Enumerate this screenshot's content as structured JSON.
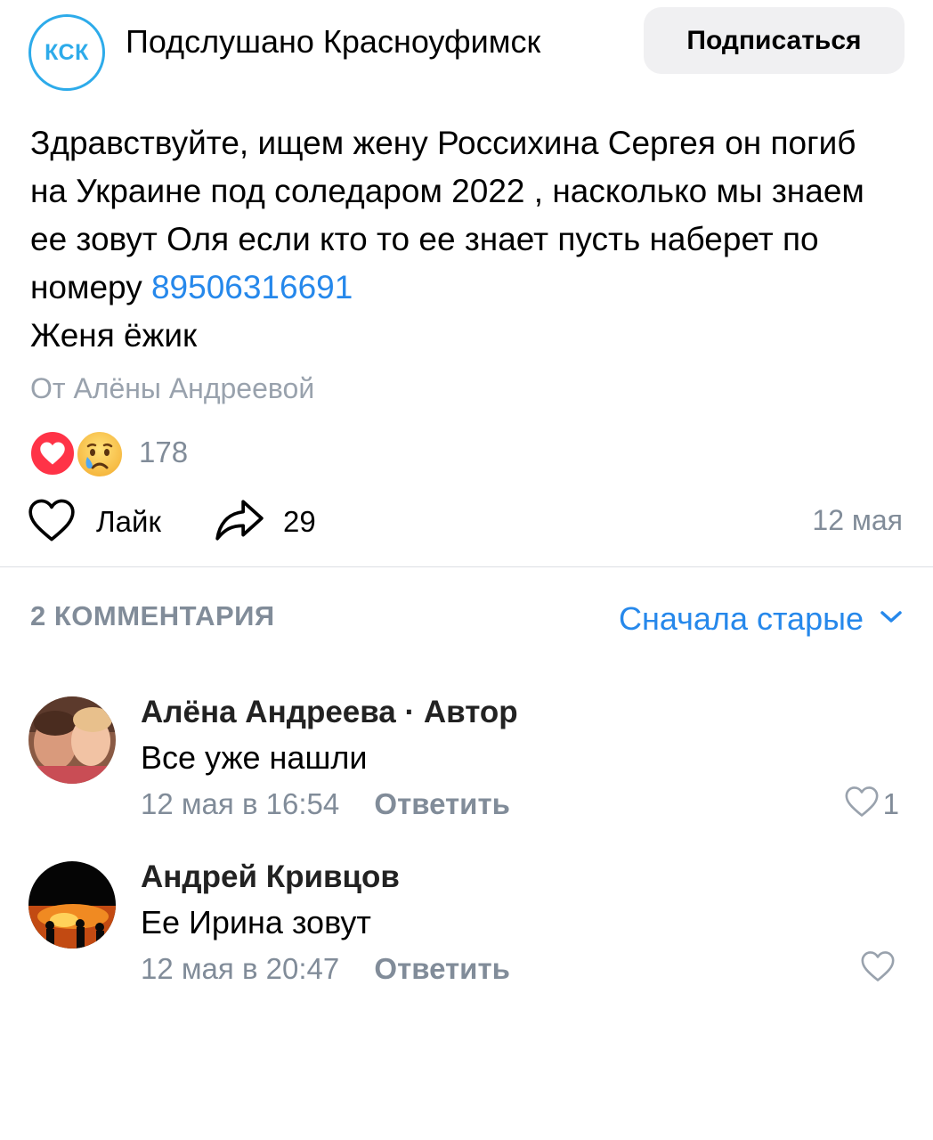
{
  "header": {
    "group_avatar_text": "КСК",
    "group_name": "Подслушано Красноуфимск",
    "subscribe_label": "Подписаться"
  },
  "post": {
    "text_before_link": "Здравствуйте, ищем жену Россихина Сергея он погиб на Украине под соледаром 2022 , насколько мы знаем ее зовут Оля если кто то ее знает пусть наберет по номеру ",
    "phone": "89506316691",
    "text_after_link": "Женя ёжик",
    "author_line": "От Алёны Андреевой",
    "reactions_count": "178",
    "like_label": "Лайк",
    "shares_count": "29",
    "date": "12 мая"
  },
  "comments_section": {
    "count_label": "2 КОММЕНТАРИЯ",
    "sort_label": "Сначала старые",
    "items": [
      {
        "author": "Алёна Андреева · Автор",
        "text": "Все уже нашли",
        "time": "12 мая в 16:54",
        "reply_label": "Ответить",
        "likes": "1"
      },
      {
        "author": "Андрей Кривцов",
        "text": "Ее Ирина зовут",
        "time": "12 мая в 20:47",
        "reply_label": "Ответить",
        "likes": ""
      }
    ]
  },
  "colors": {
    "accent_blue": "#2688eb",
    "brand_cyan": "#2dabea",
    "secondary_text": "#818c99",
    "heart_red": "#ff3347"
  },
  "icons": [
    "heart-reaction-icon",
    "crying-face-icon",
    "heart-outline-icon",
    "share-arrow-icon",
    "chevron-down-icon"
  ]
}
